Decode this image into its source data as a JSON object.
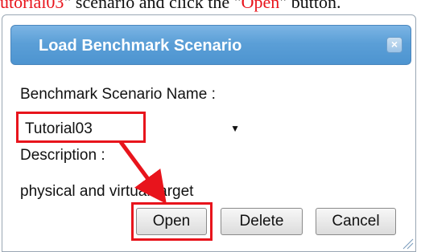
{
  "caption": {
    "part1": "utorial03",
    "part2": "\" scenario and click the \"",
    "part3": "Open",
    "part4": "\" button."
  },
  "dialog": {
    "title": "Load Benchmark Scenario",
    "close_label": "×",
    "name_label": "Benchmark Scenario Name :",
    "selected_scenario": "Tutorial03",
    "description_label": "Description :",
    "description_value": "physical and virtual target",
    "buttons": {
      "open": "Open",
      "delete": "Delete",
      "cancel": "Cancel"
    }
  },
  "colors": {
    "highlight": "#e8141c",
    "titlebar": "#5b9fd7"
  }
}
